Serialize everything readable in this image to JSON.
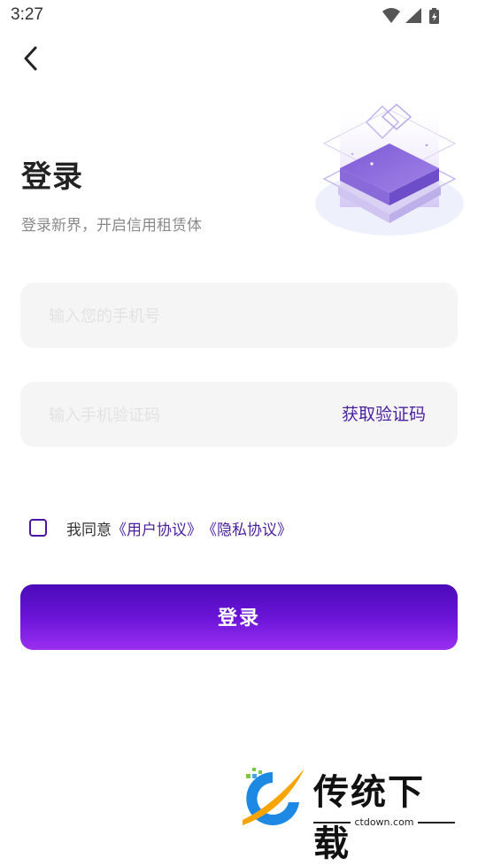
{
  "status_bar": {
    "time": "3:27",
    "icons": [
      "wifi-icon",
      "signal-icon",
      "battery-charging-icon"
    ]
  },
  "nav": {
    "back_icon": "chevron-left-icon"
  },
  "header": {
    "title": "登录",
    "subtitle": "登录新界，开启信用租赁体"
  },
  "form": {
    "phone_placeholder": "输入您的手机号",
    "phone_value": "",
    "code_placeholder": "输入手机验证码",
    "code_value": "",
    "get_code_label": "获取验证码"
  },
  "agreement": {
    "checked": false,
    "prefix": "我同意",
    "user_agreement": "《用户协议》",
    "privacy_agreement": "《隐私协议》"
  },
  "login_button": {
    "label": "登录"
  },
  "watermark": {
    "title": "传统下载",
    "url": "ctdown.com"
  },
  "colors": {
    "accent": "#4a1fa0",
    "button_gradient_top": "#4b0bb8",
    "button_gradient_bottom": "#9b2ff0",
    "input_bg": "#f5f5f5"
  }
}
